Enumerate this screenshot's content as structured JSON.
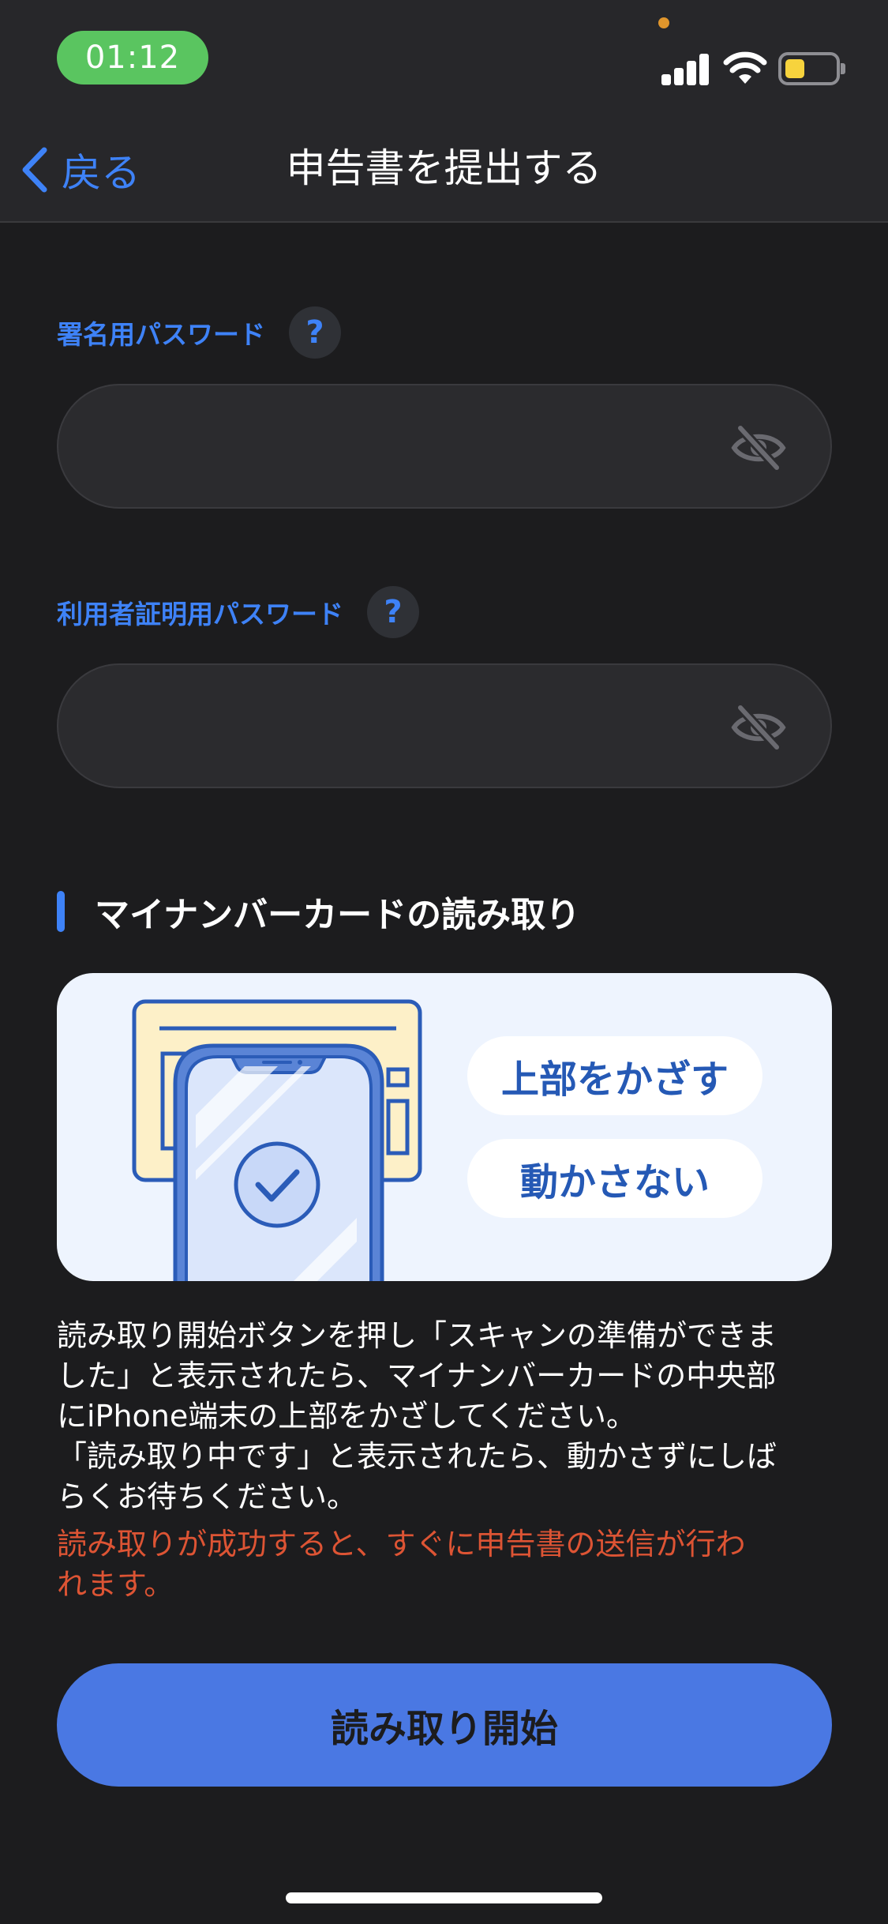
{
  "status_bar": {
    "time": "01:12"
  },
  "nav": {
    "back_label": "戻る",
    "title": "申告書を提出する"
  },
  "form": {
    "signing_password": {
      "label": "署名用パスワード",
      "help": "?",
      "value": ""
    },
    "user_cert_password": {
      "label": "利用者証明用パスワード",
      "help": "?",
      "value": ""
    }
  },
  "card_reading": {
    "section_title": "マイナンバーカードの読み取り",
    "illustration": {
      "tip_1": "上部をかざす",
      "tip_2": "動かさない"
    },
    "description_lines": [
      "読み取り開始ボタンを押し「スキャンの準備ができま",
      "した」と表示されたら、マイナンバーカードの中央部",
      "にiPhone端末の上部をかざしてください。",
      "「読み取り中です」と表示されたら、動かさずにしば",
      "らくお待ちください。"
    ],
    "warning_lines": [
      "読み取りが成功すると、すぐに申告書の送信が行わ",
      "れます。"
    ],
    "start_button": "読み取り開始"
  },
  "colors": {
    "accent": "#3e82f7",
    "warning": "#dd5434",
    "button": "#4a78e3",
    "time_pill": "#5ac560"
  },
  "icons": [
    "chevron-left-icon",
    "help-icon",
    "eye-slash-icon",
    "signal-icon",
    "wifi-icon",
    "battery-icon",
    "checkmark-circle-icon"
  ]
}
